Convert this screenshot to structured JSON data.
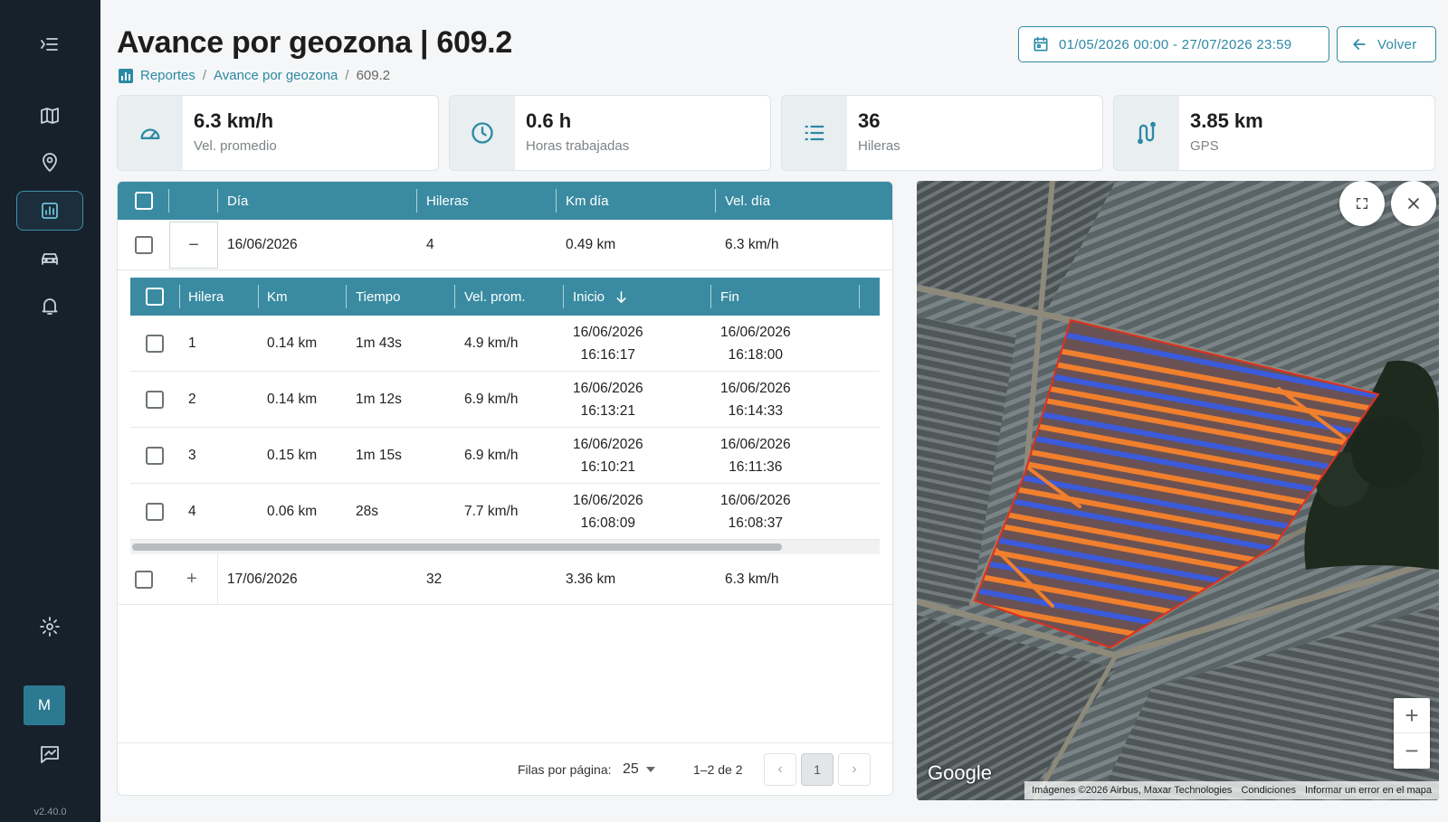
{
  "app": {
    "version": "v2.40.0",
    "user_initial": "M"
  },
  "header": {
    "title": "Avance por geozona | 609.2",
    "breadcrumb": [
      "Reportes",
      "Avance por geozona",
      "609.2"
    ],
    "date_range": "01/05/2026 00:00 - 27/07/2026 23:59",
    "back_label": "Volver"
  },
  "stats": [
    {
      "value": "6.3 km/h",
      "label": "Vel. promedio",
      "icon": "speedometer-icon"
    },
    {
      "value": "0.6 h",
      "label": "Horas trabajadas",
      "icon": "clock-icon"
    },
    {
      "value": "36",
      "label": "Hileras",
      "icon": "list-icon"
    },
    {
      "value": "3.85 km",
      "label": "GPS",
      "icon": "route-icon"
    }
  ],
  "table": {
    "columns": [
      "Día",
      "Hileras",
      "Km día",
      "Vel. día"
    ],
    "rows": [
      {
        "expander": "−",
        "dia": "16/06/2026",
        "hileras": "4",
        "km": "0.49 km",
        "vel": "6.3 km/h"
      },
      {
        "expander": "+",
        "dia": "17/06/2026",
        "hileras": "32",
        "km": "3.36 km",
        "vel": "6.3 km/h"
      }
    ],
    "subtable": {
      "columns": [
        "Hilera",
        "Km",
        "Tiempo",
        "Vel. prom.",
        "Inicio",
        "Fin"
      ],
      "sort_icon": "arrow-down-icon",
      "rows": [
        {
          "hilera": "1",
          "km": "0.14 km",
          "tiempo": "1m 43s",
          "vel": "4.9 km/h",
          "inicio_fecha": "16/06/2026",
          "inicio_hora": "16:16:17",
          "fin_fecha": "16/06/2026",
          "fin_hora": "16:18:00"
        },
        {
          "hilera": "2",
          "km": "0.14 km",
          "tiempo": "1m 12s",
          "vel": "6.9 km/h",
          "inicio_fecha": "16/06/2026",
          "inicio_hora": "16:13:21",
          "fin_fecha": "16/06/2026",
          "fin_hora": "16:14:33"
        },
        {
          "hilera": "3",
          "km": "0.15 km",
          "tiempo": "1m 15s",
          "vel": "6.9 km/h",
          "inicio_fecha": "16/06/2026",
          "inicio_hora": "16:10:21",
          "fin_fecha": "16/06/2026",
          "fin_hora": "16:11:36"
        },
        {
          "hilera": "4",
          "km": "0.06 km",
          "tiempo": "28s",
          "vel": "7.7 km/h",
          "inicio_fecha": "16/06/2026",
          "inicio_hora": "16:08:09",
          "fin_fecha": "16/06/2026",
          "fin_hora": "16:08:37"
        }
      ]
    },
    "pagination": {
      "rows_label": "Filas por página:",
      "rows_per_page": "25",
      "range": "1–2 de 2",
      "page": "1"
    }
  },
  "map": {
    "logo": "Google",
    "attribution": [
      "Imágenes ©2026 Airbus, Maxar Technologies",
      "Condiciones",
      "Informar un error en el mapa"
    ],
    "zoom_in": "+",
    "zoom_out": "−"
  },
  "colors": {
    "accent": "#2c8aa5",
    "table_header": "#3a8ba1",
    "sidebar": "#17212c",
    "track_orange": "#f07f2e",
    "track_blue": "#3b5bdb",
    "geofence": "#e0301e"
  }
}
